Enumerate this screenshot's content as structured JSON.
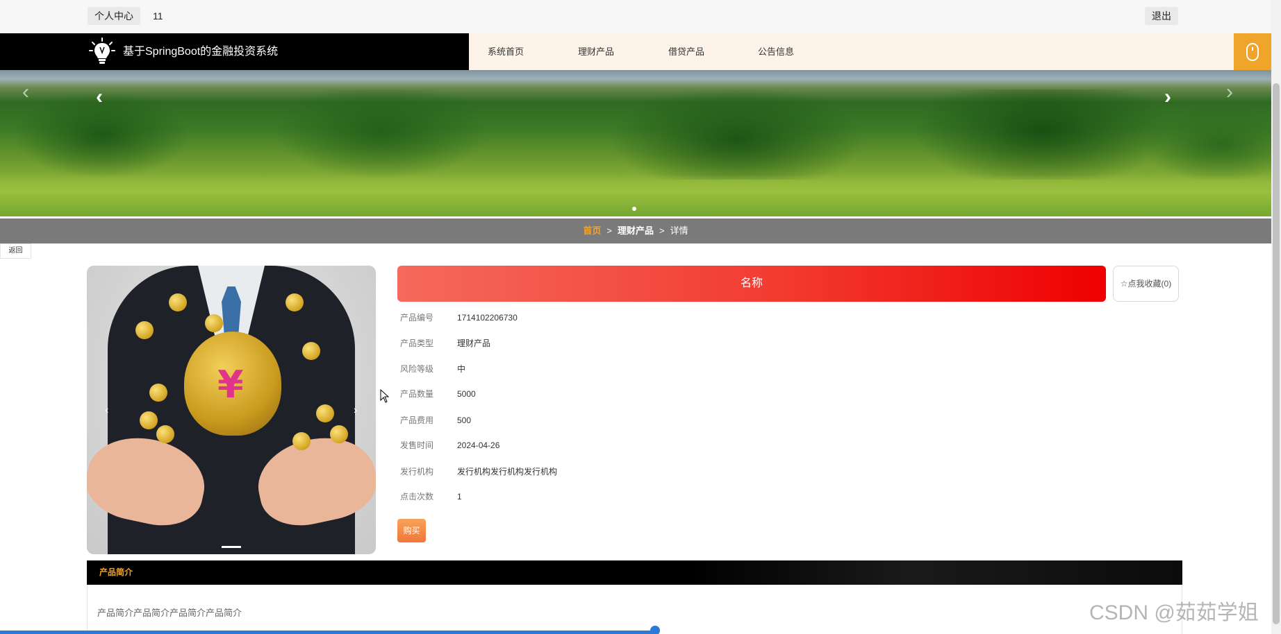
{
  "topbar": {
    "center_label": "个人中心",
    "username": "11",
    "logout_label": "退出"
  },
  "nav": {
    "site_title": "基于SpringBoot的金融投资系统",
    "items": [
      {
        "label": "系统首页"
      },
      {
        "label": "理财产品"
      },
      {
        "label": "借贷产品"
      },
      {
        "label": "公告信息"
      }
    ]
  },
  "breadcrumb": {
    "home": "首页",
    "category": "理财产品",
    "current": "详情",
    "separator": ">"
  },
  "back_label": "返回",
  "product": {
    "name": "名称",
    "favorite_label": "☆点我收藏(0)",
    "fields": [
      {
        "label": "产品编号",
        "value": "1714102206730"
      },
      {
        "label": "产品类型",
        "value": "理财产品"
      },
      {
        "label": "风险等级",
        "value": "中"
      },
      {
        "label": "产品数量",
        "value": "5000"
      },
      {
        "label": "产品费用",
        "value": "500"
      },
      {
        "label": "发售时间",
        "value": "2024-04-26"
      },
      {
        "label": "发行机构",
        "value": "发行机构发行机构发行机构"
      },
      {
        "label": "点击次数",
        "value": "1"
      }
    ],
    "buy_label": "购买"
  },
  "intro": {
    "tab_label": "产品简介",
    "text": "产品简介产品简介产品简介产品简介"
  },
  "watermark": "CSDN @茹茹学姐",
  "colors": {
    "accent": "#f0a42a",
    "brand_bar": "#000000",
    "name_bar_start": "#f56a5c",
    "name_bar_end": "#ee0000"
  }
}
